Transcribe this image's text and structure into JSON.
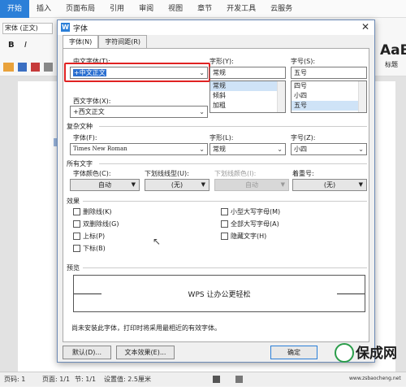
{
  "menubar": {
    "items": [
      "开始",
      "插入",
      "页面布局",
      "引用",
      "审阅",
      "视图",
      "章节",
      "开发工具",
      "云服务"
    ]
  },
  "ribbon": {
    "font_value": "宋体 (正文)",
    "style_preview": "AaB",
    "style_label": "标题"
  },
  "status": {
    "pages": "页码: 1",
    "page_of": "页面: 1/1",
    "section": "节: 1/1",
    "setting": "设置值: 2.5厘米"
  },
  "dialog": {
    "title": "字体",
    "tabs": [
      "字体(N)",
      "字符间距(R)"
    ],
    "chinese_font_label": "中文字体(T):",
    "chinese_font_value": "+中文正文",
    "style_label": "字形(Y):",
    "style_value": "常规",
    "style_options": [
      "常规",
      "倾斜",
      "加粗"
    ],
    "size_label": "字号(S):",
    "size_value": "五号",
    "size_options": [
      "四号",
      "小四",
      "五号"
    ],
    "western_font_label": "西文字体(X):",
    "western_font_value": "+西文正文",
    "complex_section": "复杂文种",
    "complex_font_label": "字体(F):",
    "complex_font_value": "Times New Roman",
    "complex_style_label": "字形(L):",
    "complex_style_value": "常规",
    "complex_size_label": "字号(Z):",
    "complex_size_value": "小四",
    "all_text_section": "所有文字",
    "font_color_label": "字体颜色(C):",
    "font_color_value": "自动",
    "underline_type_label": "下划线线型(U):",
    "underline_type_value": "(无)",
    "underline_color_label": "下划线颜色(I):",
    "underline_color_value": "自动",
    "emphasis_label": "着重号:",
    "emphasis_value": "(无)",
    "effects_section": "效果",
    "effects_left": [
      "删除线(K)",
      "双删除线(G)",
      "上标(P)",
      "下标(B)"
    ],
    "effects_right": [
      "小型大写字母(M)",
      "全部大写字母(A)",
      "隐藏文字(H)"
    ],
    "preview_section": "预览",
    "preview_text": "WPS 让办公更轻松",
    "note": "尚未安装此字体，打印时将采用最相近的有效字体。",
    "buttons": {
      "default": "默认(D)...",
      "text_effect": "文本效果(E)...",
      "ok": "确定"
    }
  },
  "watermark": {
    "brand": "保成网",
    "url": "www.zsbaocheng.net"
  }
}
